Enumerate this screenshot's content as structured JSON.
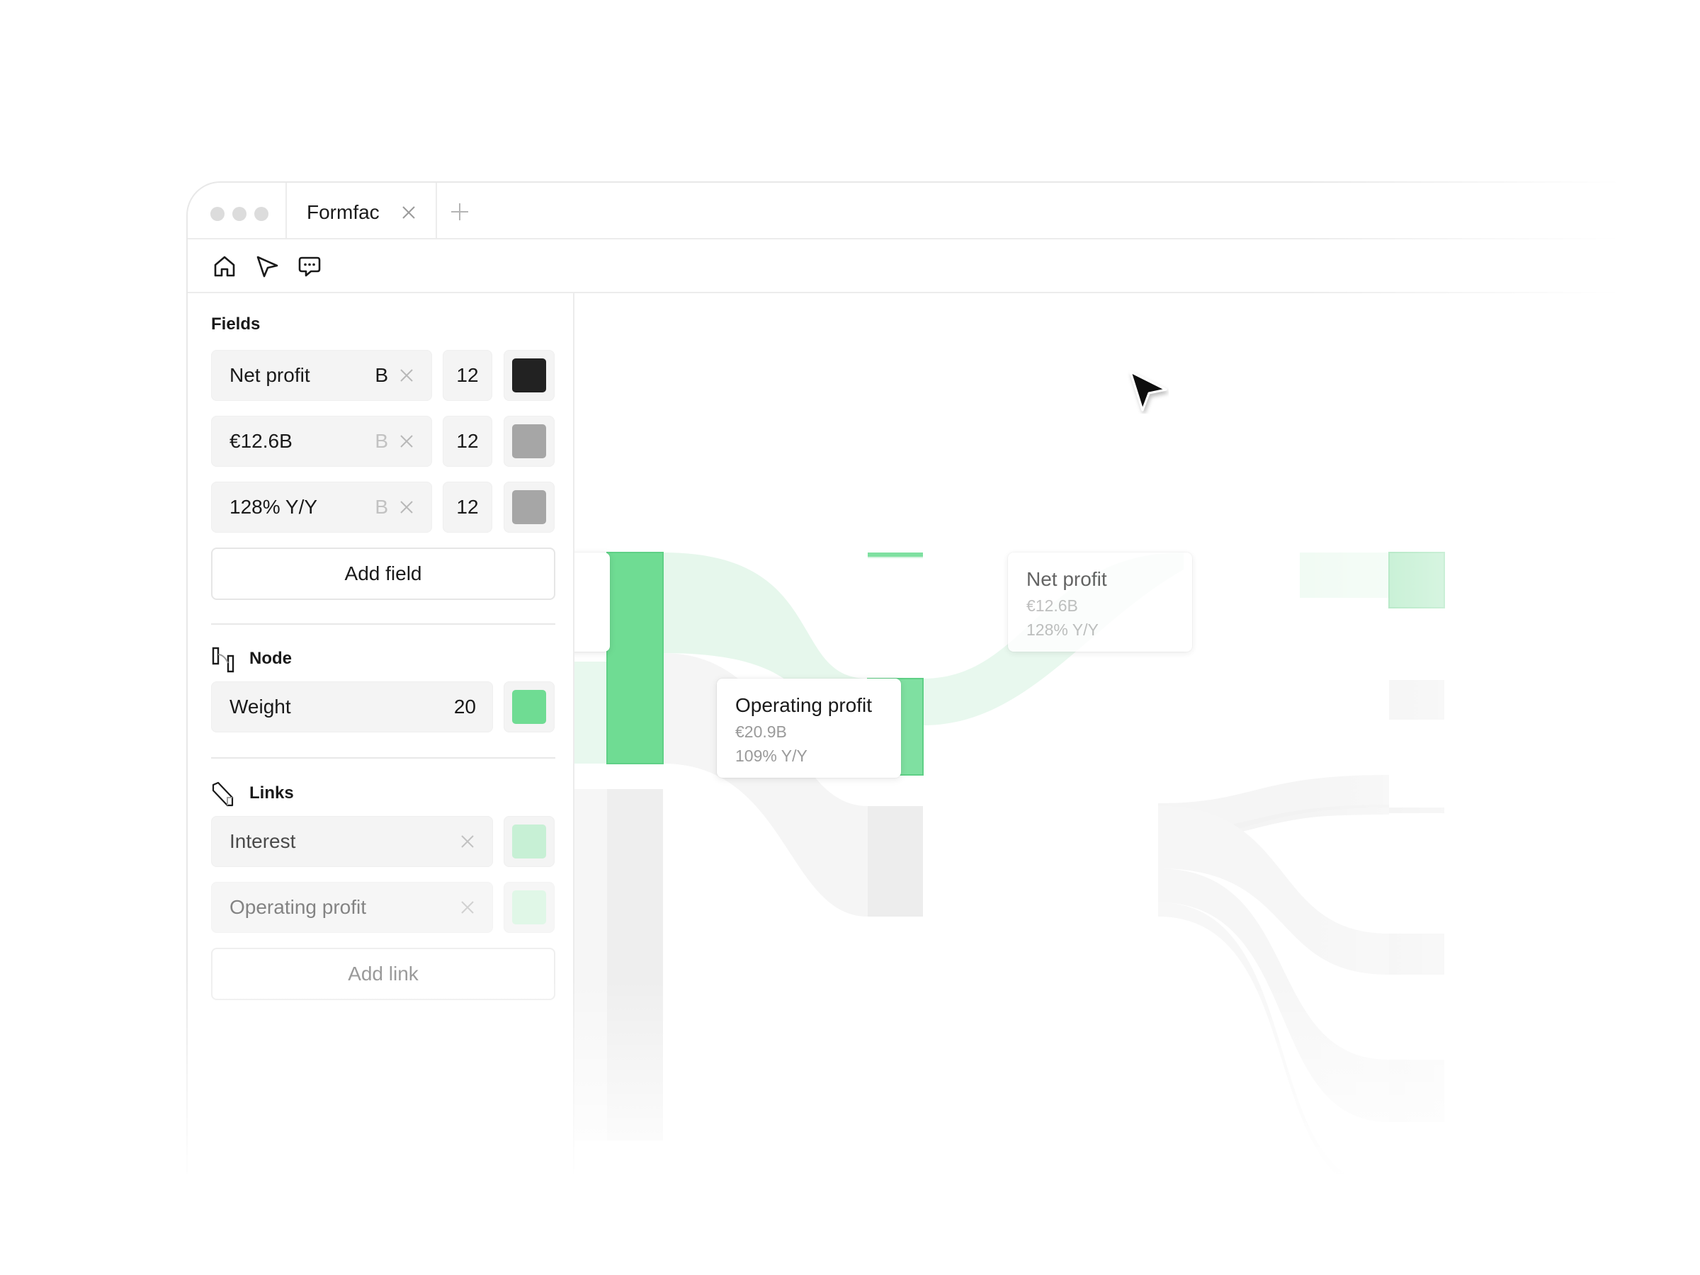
{
  "tab": {
    "title": "Formfac"
  },
  "toolbar": {
    "icons": [
      "home-icon",
      "cursor-icon",
      "chat-icon"
    ]
  },
  "fields_section": {
    "title": "Fields",
    "items": [
      {
        "label": "Net profit",
        "style": "B",
        "size": "12",
        "color": "#222222"
      },
      {
        "label": "€12.6B",
        "style": "B",
        "size": "12",
        "color": "#a6a6a6"
      },
      {
        "label": "128% Y/Y",
        "style": "B",
        "size": "12",
        "color": "#a6a6a6"
      }
    ],
    "add_label": "Add field"
  },
  "node_section": {
    "title": "Node",
    "weight_label": "Weight",
    "weight_value": "20",
    "color": "#6fdc93"
  },
  "links_section": {
    "title": "Links",
    "items": [
      {
        "label": "Interest",
        "color": "#c7f0d5"
      },
      {
        "label": "Operating profit",
        "color": "#d6f5e0"
      }
    ],
    "add_label": "Add link"
  },
  "canvas": {
    "cards": {
      "operating_profit": {
        "title": "Operating profit",
        "value": "€20.9B",
        "change": "109% Y/Y"
      },
      "net_profit": {
        "title": "Net profit",
        "value": "€12.6B",
        "change": "128% Y/Y"
      }
    }
  },
  "colors": {
    "accent_green": "#6fdc93",
    "light_green": "#c7f0d5",
    "flow_green": "#e7f8ed",
    "neutral_node": "#ededed",
    "neutral_flow": "#f4f4f4"
  }
}
